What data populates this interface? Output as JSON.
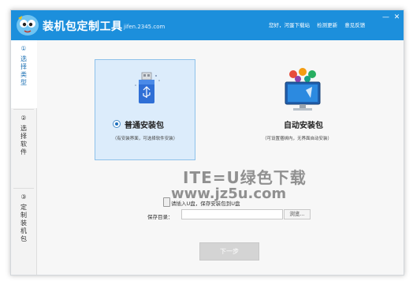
{
  "window": {
    "title": "装机包定制工具",
    "domain": "jifen.2345.com"
  },
  "top_links": {
    "greeting": "您好，河蛋下载站",
    "check_update": "检测更新",
    "feedback": "意见反馈"
  },
  "window_controls": {
    "minimize": "—",
    "close": "✕"
  },
  "sidebar": {
    "steps": [
      {
        "num": "①",
        "label": "选择类型"
      },
      {
        "num": "②",
        "label": "选择软件"
      },
      {
        "num": "③",
        "label": "定制装机包"
      }
    ]
  },
  "packages": {
    "normal": {
      "title": "普通安装包",
      "desc": "（有安装界面，可选择软件安装）",
      "selected": true
    },
    "auto": {
      "title": "自动安装包",
      "desc": "（可设置捆绑内，无界面自动安装）",
      "selected": false
    }
  },
  "usb": {
    "hint": "请插入U盘，保存安装包到U盘"
  },
  "save": {
    "label": "保存目录：",
    "value": "",
    "browse": "浏览..."
  },
  "next": {
    "label": "下一步"
  },
  "watermark": {
    "line1": "ITE=U绿色下载",
    "line2": "www.jz5u.com"
  },
  "colors": {
    "titlebar": "#1c8fdc",
    "selected_card": "#dcecfb",
    "accent": "#1c6fbe"
  }
}
